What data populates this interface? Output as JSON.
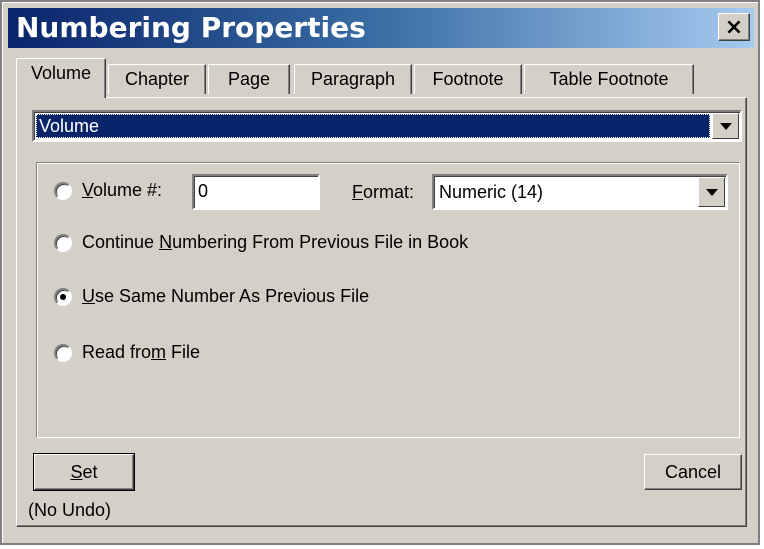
{
  "window": {
    "title": "Numbering Properties",
    "close_label": "×"
  },
  "tabs": [
    {
      "label": "Volume",
      "active": true
    },
    {
      "label": "Chapter",
      "active": false
    },
    {
      "label": "Page",
      "active": false
    },
    {
      "label": "Paragraph",
      "active": false
    },
    {
      "label": "Footnote",
      "active": false
    },
    {
      "label": "Table Footnote",
      "active": false
    }
  ],
  "component_select": {
    "value": "Volume"
  },
  "options": {
    "volume_number": {
      "label_prefix": "V",
      "label_rest": "olume #:",
      "value": "0",
      "checked": false
    },
    "format": {
      "label_prefix": "F",
      "label_rest": "ormat:",
      "value": "Numeric  (14)"
    },
    "continue": {
      "label_before": "Continue ",
      "label_mnemonic": "N",
      "label_after": "umbering From Previous File in Book",
      "checked": false
    },
    "same_number": {
      "label_mnemonic": "U",
      "label_after": "se Same Number As Previous File",
      "checked": true
    },
    "read_from_file": {
      "label_before": "Read fro",
      "label_mnemonic": "m",
      "label_after": " File",
      "checked": false
    }
  },
  "buttons": {
    "set_mnemonic": "S",
    "set_rest": "et",
    "no_undo": "(No Undo)",
    "cancel": "Cancel"
  }
}
